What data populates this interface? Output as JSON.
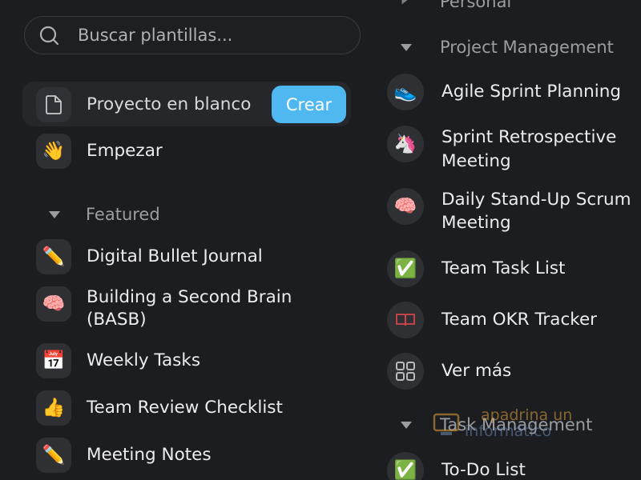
{
  "search": {
    "placeholder": "Buscar plantillas..."
  },
  "blank_project": {
    "label": "Proyecto en blanco",
    "create_label": "Crear"
  },
  "left": {
    "start": {
      "icon": "👋",
      "label": "Empezar"
    },
    "featured_title": "Featured",
    "featured": [
      {
        "icon": "✏️",
        "label": "Digital Bullet Journal"
      },
      {
        "icon": "🧠",
        "label_line1": "Building a Second Brain",
        "label_line2": "(BASB)"
      },
      {
        "icon": "📅",
        "label": "Weekly Tasks"
      },
      {
        "icon": "👍",
        "label": "Team Review Checklist"
      },
      {
        "icon": "✏️",
        "label": "Meeting Notes"
      }
    ]
  },
  "right": {
    "personal_title": "Personal",
    "pm_title": "Project Management",
    "pm": [
      {
        "icon": "👟",
        "label": "Agile Sprint Planning"
      },
      {
        "icon": "🦄",
        "label_line1": "Sprint Retrospective",
        "label_line2": "Meeting"
      },
      {
        "icon": "🧠",
        "label_line1": "Daily Stand-Up Scrum",
        "label_line2": "Meeting"
      },
      {
        "icon": "✅",
        "label": "Team Task List"
      },
      {
        "icon": "📖",
        "label": "Team OKR Tracker"
      },
      {
        "icon": "grid-icon",
        "label": "Ver más"
      }
    ],
    "tm_title": "Task Management",
    "tm": [
      {
        "icon": "✅",
        "label": "To-Do List"
      }
    ]
  },
  "watermark": {
    "line1": "apadrina un",
    "line2": "informático"
  }
}
